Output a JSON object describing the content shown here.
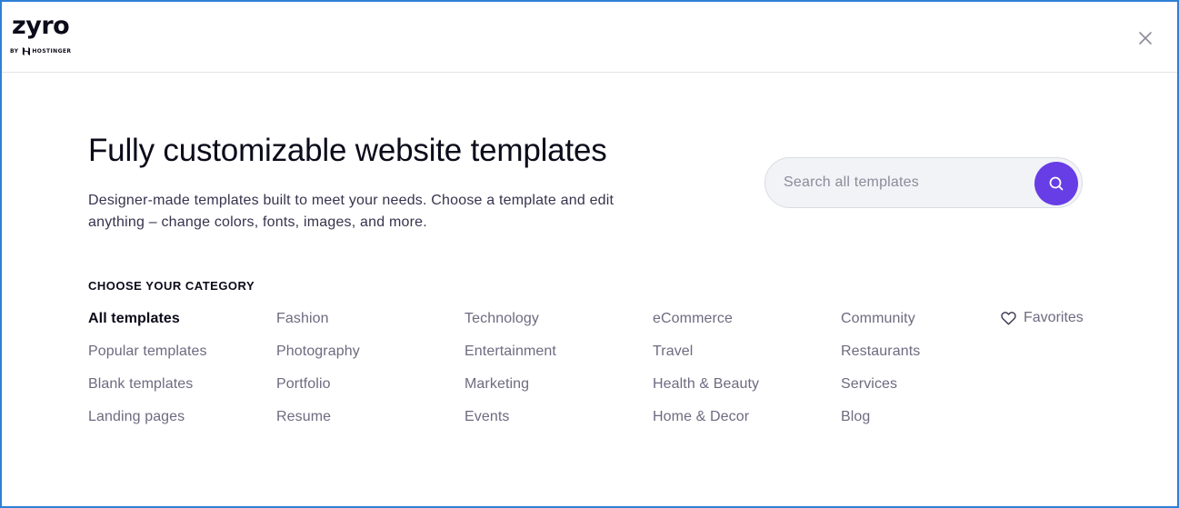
{
  "header": {
    "logo_text": "zyro",
    "logo_by": "BY",
    "logo_brand": "HOSTINGER",
    "close_icon": "close-icon"
  },
  "hero": {
    "title": "Fully customizable website templates",
    "description": "Designer-made templates built to meet your needs. Choose a template and edit anything – change colors, fonts, images, and more."
  },
  "search": {
    "placeholder": "Search all templates",
    "value": "",
    "icon": "search-icon",
    "button_color": "#673de6"
  },
  "categories": {
    "title": "CHOOSE YOUR CATEGORY",
    "columns": [
      [
        "All templates",
        "Popular templates",
        "Blank templates",
        "Landing pages"
      ],
      [
        "Fashion",
        "Photography",
        "Portfolio",
        "Resume"
      ],
      [
        "Technology",
        "Entertainment",
        "Marketing",
        "Events"
      ],
      [
        "eCommerce",
        "Travel",
        "Health & Beauty",
        "Home & Decor"
      ],
      [
        "Community",
        "Restaurants",
        "Services",
        "Blog"
      ]
    ],
    "active": "All templates",
    "favorites_label": "Favorites",
    "favorites_icon": "heart-icon"
  },
  "colors": {
    "accent": "#673de6",
    "frame_border": "#2f7fd6",
    "text_dark": "#0b0b1a",
    "text_muted": "#6d6b80"
  }
}
